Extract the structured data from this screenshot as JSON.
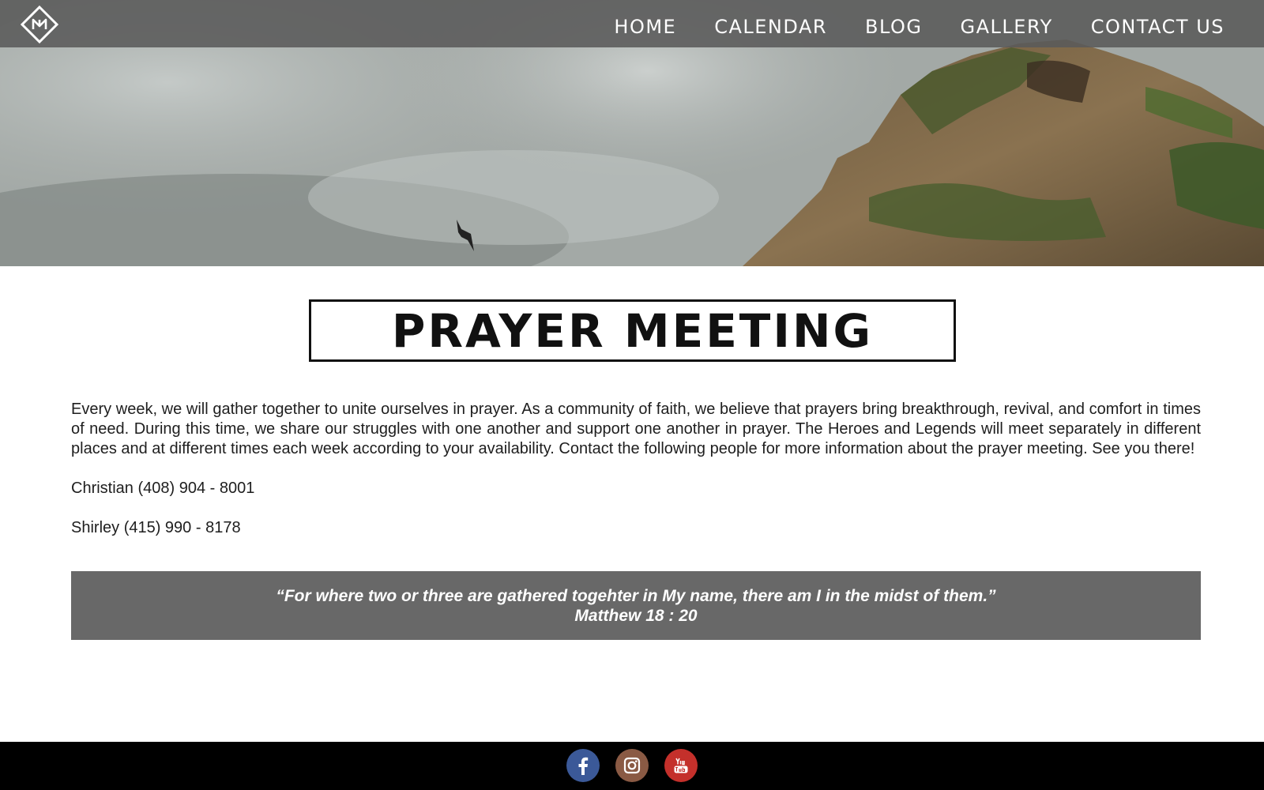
{
  "header": {
    "logo_icon": "diamond-monogram-icon",
    "nav": [
      {
        "label": "HOME"
      },
      {
        "label": "CALENDAR"
      },
      {
        "label": "BLOG"
      },
      {
        "label": "GALLERY"
      },
      {
        "label": "CONTACT US"
      }
    ]
  },
  "hero": {
    "image": "foggy-mountain-cliff-with-bird"
  },
  "main": {
    "title": "PRAYER MEETING",
    "intro": "Every week, we will gather together to unite ourselves in prayer. As a community of faith, we believe that prayers bring breakthrough, revival, and comfort in times of need. During this time, we share our struggles with one another and support one another in prayer. The Heroes and Legends will meet separately in different places and at different times each week according to your availability. Contact the following people for more information about the prayer meeting. See you there!",
    "contacts": [
      {
        "text": "Christian (408) 904 - 8001"
      },
      {
        "text": "Shirley (415) 990 - 8178"
      }
    ]
  },
  "quote": {
    "text": "“For where two or three are gathered togehter in My name, there am I in the midst of them.”",
    "reference": "Matthew 18 : 20"
  },
  "footer": {
    "social": [
      {
        "icon": "facebook-icon",
        "color": "#3b5998"
      },
      {
        "icon": "instagram-icon",
        "color": "#8a5a44"
      },
      {
        "icon": "youtube-icon",
        "color": "#c4302b"
      }
    ]
  },
  "colors": {
    "nav_bg": "#5a5a5a",
    "quote_bg": "#686868",
    "footer_bg": "#000000"
  }
}
